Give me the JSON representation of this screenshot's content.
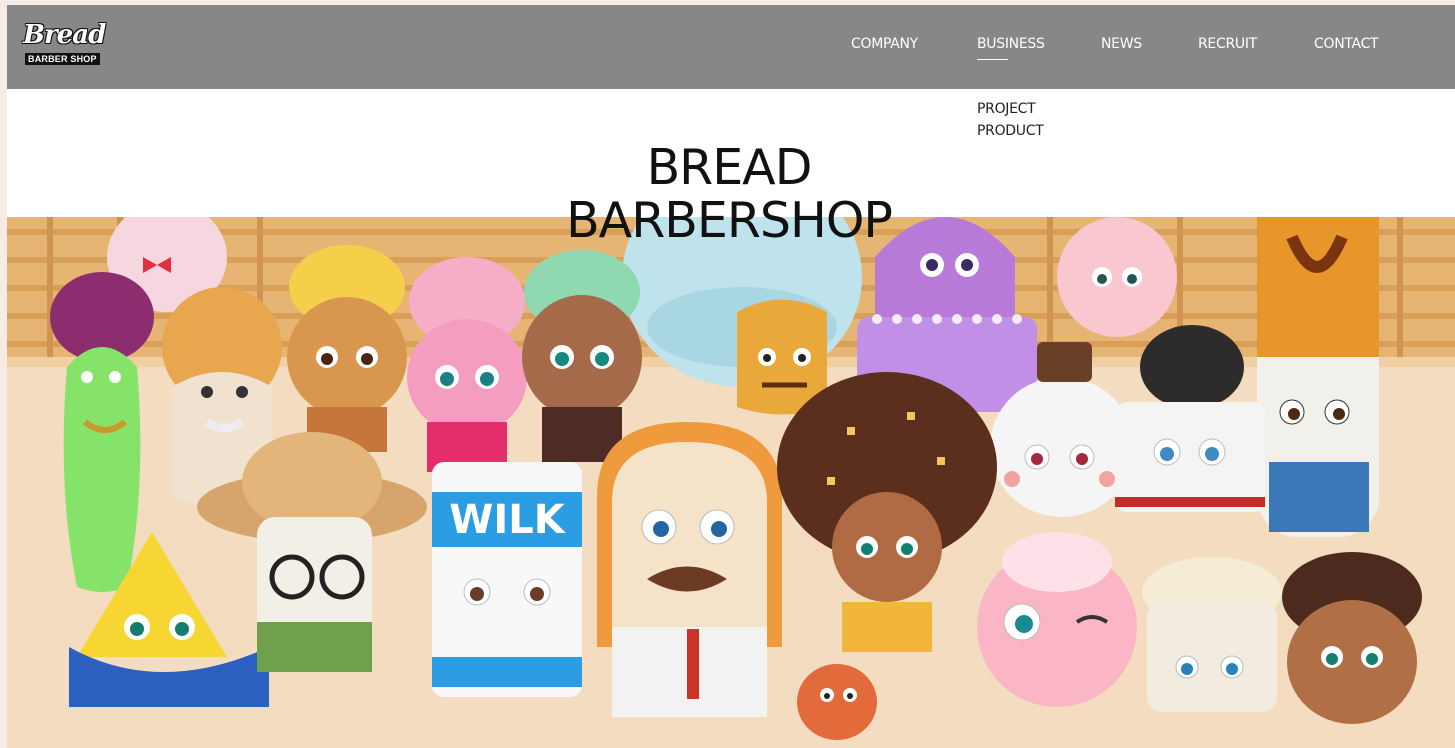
{
  "brand": {
    "logo_text_main": "Bread",
    "logo_text_sub": "BARBER SHOP"
  },
  "nav": {
    "items": [
      {
        "label": "COMPANY"
      },
      {
        "label": "BUSINESS",
        "active": true
      },
      {
        "label": "NEWS"
      },
      {
        "label": "RECRUIT"
      },
      {
        "label": "CONTACT"
      }
    ],
    "submenu": [
      {
        "label": "PROJECT"
      },
      {
        "label": "PRODUCT"
      }
    ]
  },
  "hero": {
    "title_line1": "BREAD",
    "title_line2": "BARBERSHOP",
    "milk_carton_label": "WILK"
  },
  "colors": {
    "topbar": "#878787",
    "backdrop_wood": "#e8b877",
    "floor": "#f3dcc0"
  }
}
